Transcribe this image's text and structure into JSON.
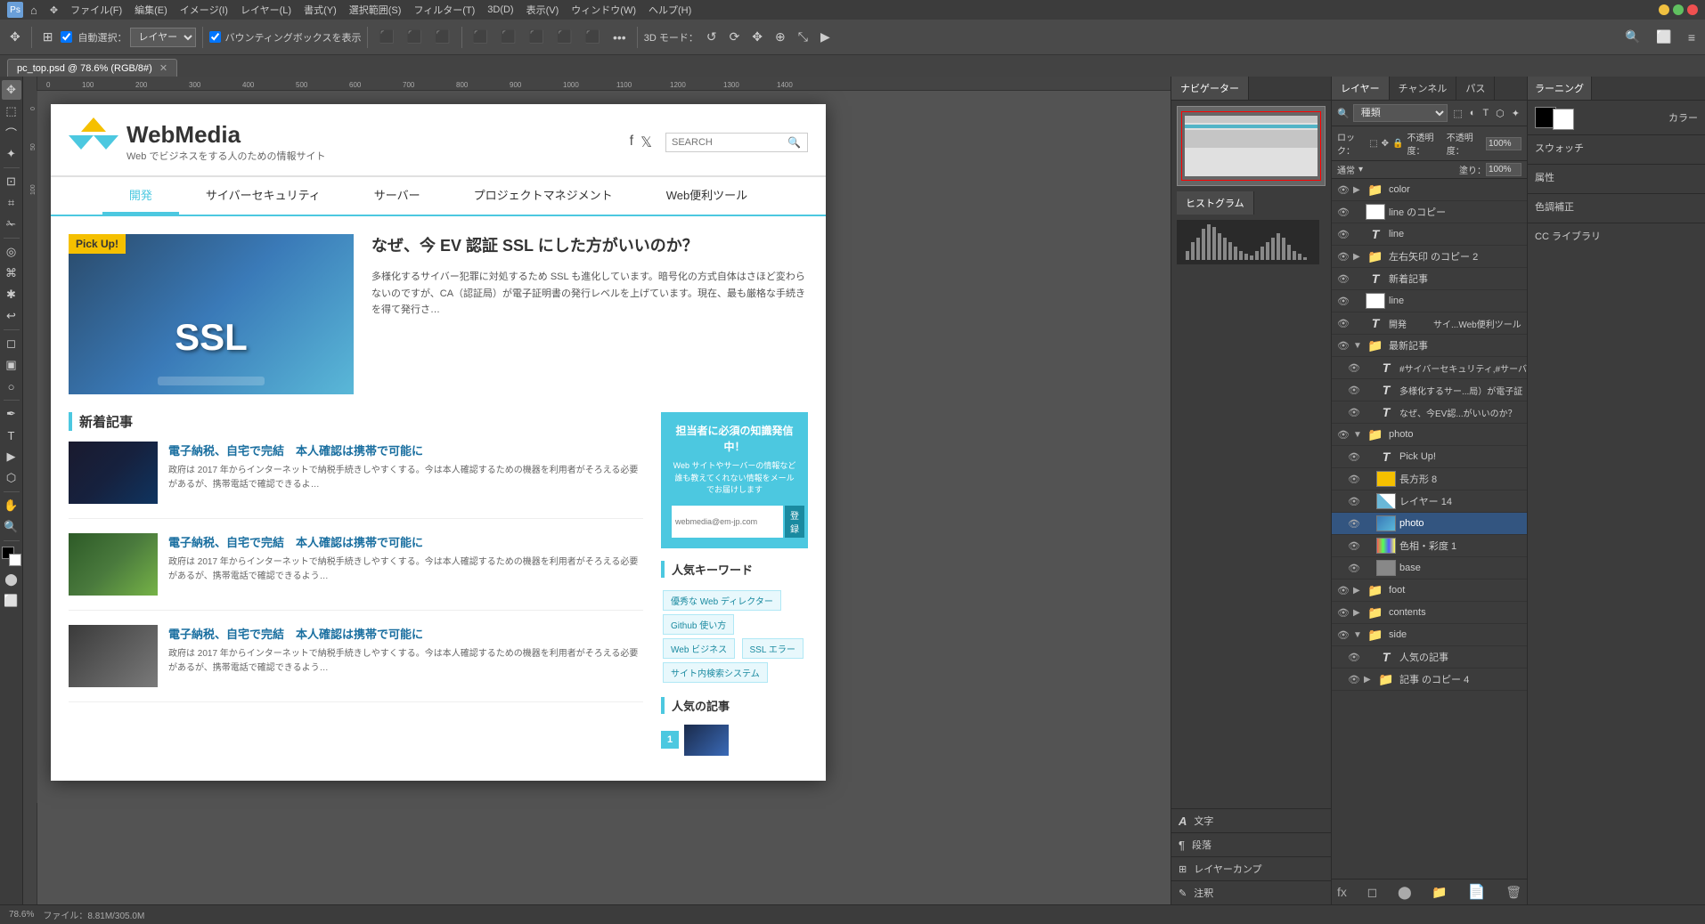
{
  "app": {
    "title": "pc_top.psd @ 78.6% (RGB/8#)",
    "zoom": "78.6%",
    "file_info": "ファイル：8.81M/305.0M"
  },
  "menubar": {
    "items": [
      "ファイル(F)",
      "編集(E)",
      "イメージ(I)",
      "レイヤー(L)",
      "書式(Y)",
      "選択範囲(S)",
      "フィルター(T)",
      "3D(D)",
      "表示(V)",
      "ウィンドウ(W)",
      "ヘルプ(H)"
    ]
  },
  "toolbar": {
    "auto_select_label": "自動選択：",
    "layer_label": "レイヤー ▾",
    "bounding_box_label": "バウンティングボックスを表示",
    "mode_label": "3D モード："
  },
  "tab": {
    "filename": "pc_top.psd @ 78.6% (RGB/8#)"
  },
  "website": {
    "logo_name": "WebMedia",
    "logo_desc": "Web でビジネスをする人のための情報サイト",
    "search_placeholder": "SEARCH",
    "nav_items": [
      "開発",
      "サイバーセキュリティ",
      "サーバー",
      "プロジェクトマネジメント",
      "Web便利ツール"
    ],
    "hero": {
      "badge": "Pick Up!",
      "ssl_text": "SSL",
      "title": "なぜ、今 EV 認証 SSL にした方がいいのか？",
      "excerpt": "多様化するサイバー犯罪に対処するため SSL も進化しています。暗号化の方式自体はさほど変わらないのですが、CA（認証局）が電子証明書の発行レベルを上げています。現在、最も厳格な手続きを得て発行さ…"
    },
    "new_articles": {
      "title": "新着記事",
      "items": [
        {
          "title": "電子納税、自宅で完結　本人確認は携帯で可能に",
          "excerpt": "政府は 2017 年からインターネットで納税手続きしやすくする。今は本人確認するための機器を利用者がそろえる必要があるが、携帯電話で確認できるよ…"
        },
        {
          "title": "電子納税、自宅で完結　本人確認は携帯で可能に",
          "excerpt": "政府は 2017 年からインターネットで納税手続きしやすくする。今は本人確認するための機器を利用者がそろえる必要があるが、携帯電話で確認できるよう…"
        },
        {
          "title": "電子納税、自宅で完結　本人確認は携帯で可能に",
          "excerpt": "政府は 2017 年からインターネットで納税手続きしやすくする。今は本人確認するための機器を利用者がそろえる必要があるが、携帯電話で確認できるよう…"
        }
      ]
    },
    "sidebar": {
      "newsletter": {
        "title": "担当者に必須の知識発信中！",
        "desc": "Web サイトやサーバーの情報など誰も教えてくれない情報をメールでお届けします",
        "placeholder": "webmedia@em-jp.com",
        "btn_label": "登録"
      },
      "keywords_title": "人気キーワード",
      "keywords": [
        "優秀な Web ディレクター",
        "Github 使い方",
        "Web ビジネス",
        "SSL エラー",
        "サイト内検索システム"
      ],
      "popular_title": "人気の記事",
      "popular_num": "1"
    }
  },
  "layers_panel": {
    "tabs": [
      "レイヤー",
      "チャンネル",
      "パス"
    ],
    "filter_placeholder": "種類",
    "opacity_label": "不透明度：",
    "opacity_value": "100%",
    "fill_label": "塗り：",
    "fill_value": "100%",
    "lock_label": "ロック：",
    "layers": [
      {
        "name": "color",
        "type": "folder",
        "visible": true,
        "indent": 0
      },
      {
        "name": "line のコピー",
        "type": "layer",
        "visible": true,
        "indent": 0
      },
      {
        "name": "line",
        "type": "text",
        "visible": true,
        "indent": 0
      },
      {
        "name": "左右矢印 のコピー 2",
        "type": "folder",
        "visible": true,
        "indent": 0
      },
      {
        "name": "新着記事",
        "type": "text",
        "visible": true,
        "indent": 0
      },
      {
        "name": "line",
        "type": "layer",
        "visible": true,
        "indent": 0
      },
      {
        "name": "開発　　　　サイ...Web便利ツール",
        "type": "text",
        "visible": true,
        "indent": 0
      },
      {
        "name": "最新記事",
        "type": "folder",
        "visible": true,
        "indent": 0,
        "expanded": true
      },
      {
        "name": "#サイバーセキュリティ,#サーバー",
        "type": "text",
        "visible": true,
        "indent": 1
      },
      {
        "name": "多様化するサー...局）が電子証",
        "type": "text",
        "visible": true,
        "indent": 1
      },
      {
        "name": "なぜ、今EV認...がいいのか？",
        "type": "text",
        "visible": true,
        "indent": 1
      },
      {
        "name": "photo",
        "type": "folder",
        "visible": true,
        "indent": 0,
        "expanded": true
      },
      {
        "name": "Pick Up!",
        "type": "text",
        "visible": true,
        "indent": 1
      },
      {
        "name": "長方形 8",
        "type": "shape",
        "visible": true,
        "indent": 1
      },
      {
        "name": "レイヤー 14",
        "type": "layer",
        "visible": true,
        "indent": 1
      },
      {
        "name": "photo",
        "type": "layer",
        "visible": true,
        "indent": 1
      },
      {
        "name": "色相・彩度 1",
        "type": "adjustment",
        "visible": true,
        "indent": 1
      },
      {
        "name": "base",
        "type": "layer",
        "visible": true,
        "indent": 1
      },
      {
        "name": "foot",
        "type": "folder",
        "visible": true,
        "indent": 0
      },
      {
        "name": "contents",
        "type": "folder",
        "visible": true,
        "indent": 0
      },
      {
        "name": "side",
        "type": "folder",
        "visible": true,
        "indent": 0,
        "expanded": true
      },
      {
        "name": "人気の記事",
        "type": "text",
        "visible": true,
        "indent": 1
      },
      {
        "name": "記事 のコピー 4",
        "type": "folder",
        "visible": true,
        "indent": 1
      }
    ]
  },
  "right_panels": {
    "navigator_tab": "ナビゲーター",
    "histogram_tab": "ヒストグラム",
    "sections": [
      {
        "label": "文字",
        "icon": "A"
      },
      {
        "label": "段落",
        "icon": "¶"
      },
      {
        "label": "レイヤーカンプ"
      },
      {
        "label": "注釈"
      }
    ]
  },
  "right_side_panels": {
    "tabs": [
      "カラー",
      "スウォッチ",
      "属性",
      "色調補正",
      "CC ライブラリ"
    ],
    "learning_label": "ラーニング"
  }
}
